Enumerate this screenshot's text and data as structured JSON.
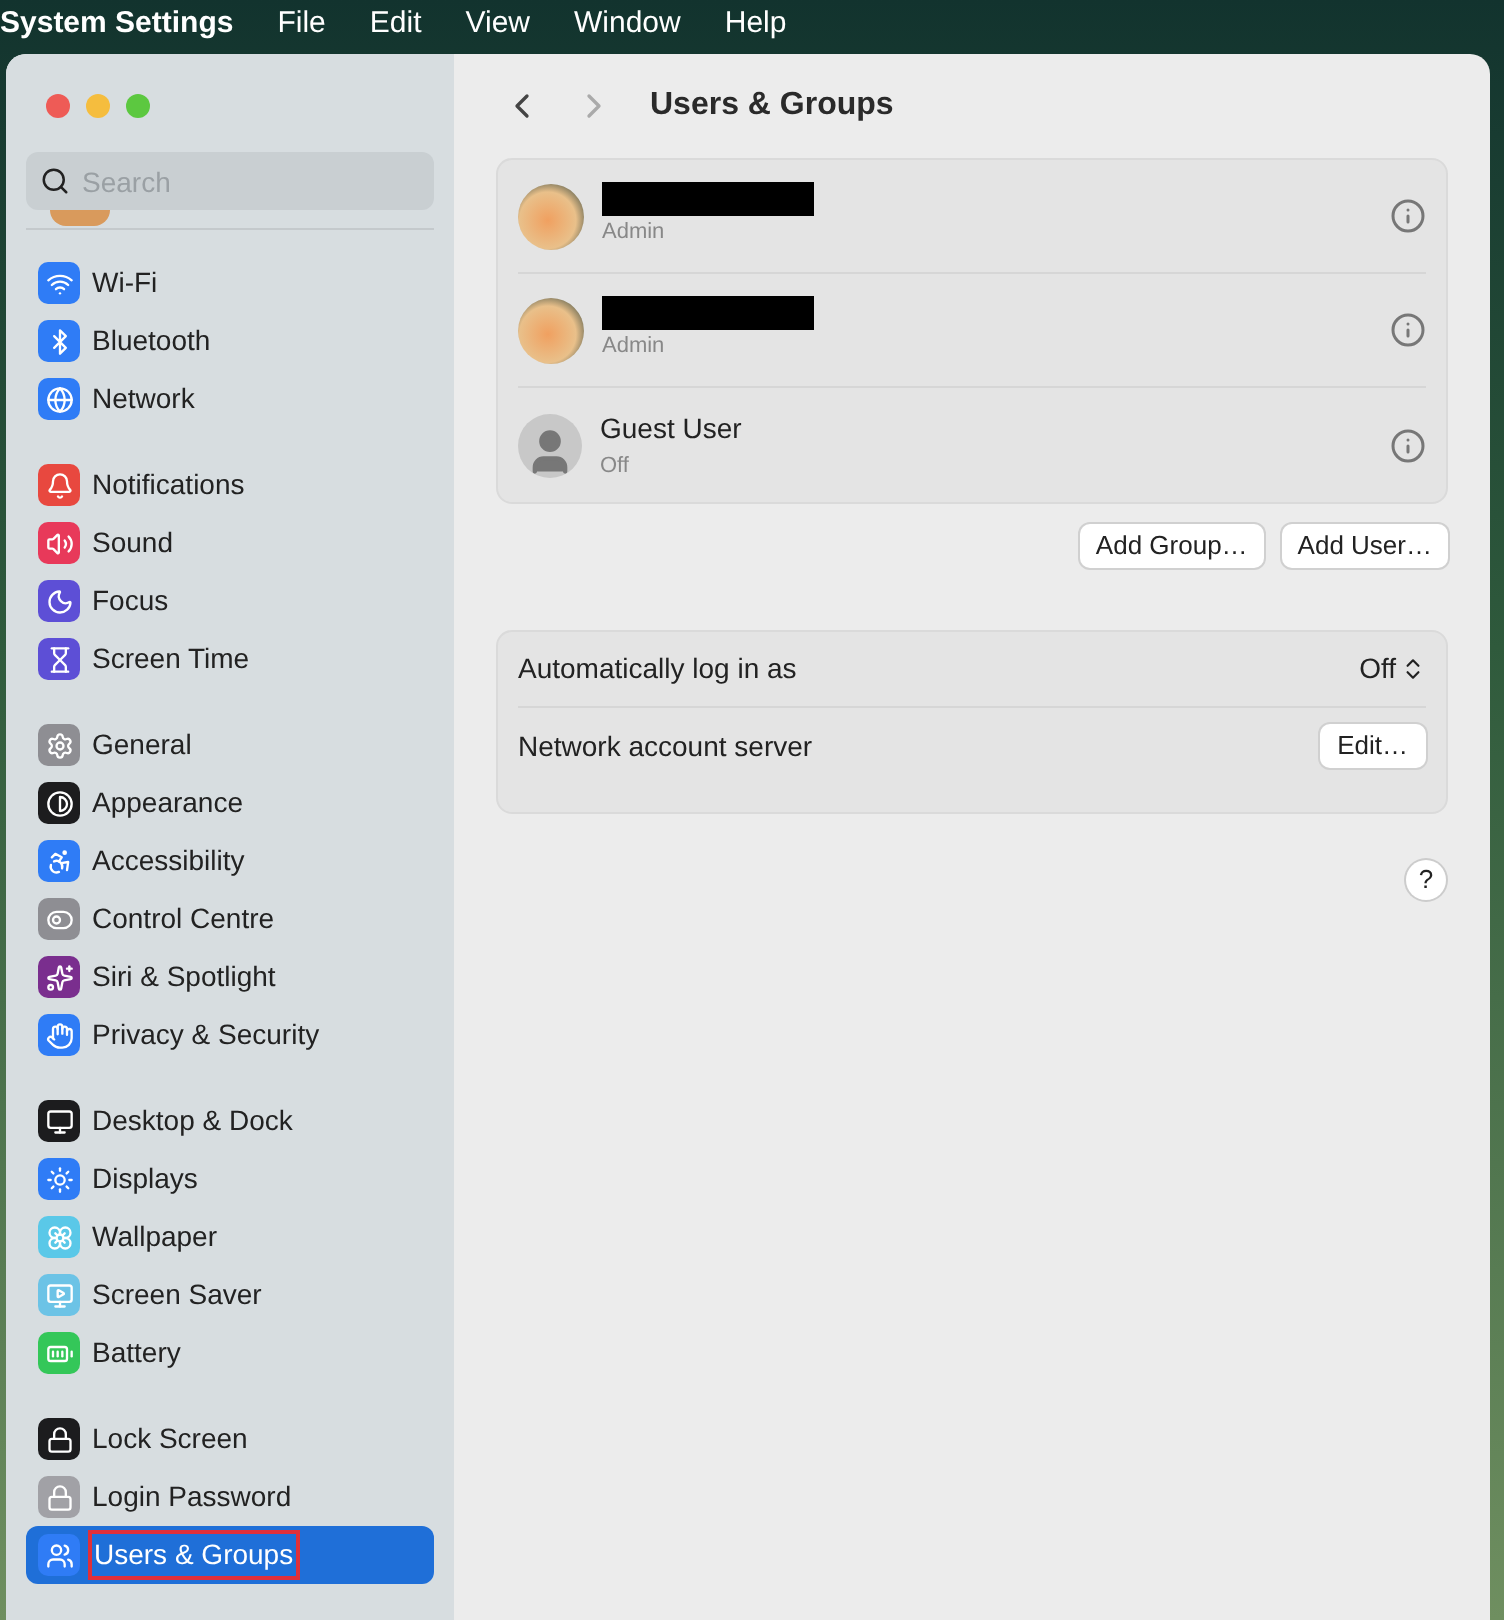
{
  "menu_bar": {
    "app": "System Settings",
    "items": [
      "File",
      "Edit",
      "View",
      "Window",
      "Help"
    ]
  },
  "search": {
    "placeholder": "Search"
  },
  "sidebar": {
    "groups": [
      {
        "items": [
          {
            "label": "Wi-Fi",
            "color": "#2f7cf6",
            "selected": false,
            "highlighted": false
          },
          {
            "label": "Bluetooth",
            "color": "#2f7cf6",
            "selected": false,
            "highlighted": false
          },
          {
            "label": "Network",
            "color": "#2f7cf6",
            "selected": false,
            "highlighted": false
          }
        ]
      },
      {
        "items": [
          {
            "label": "Notifications",
            "color": "#e8483f",
            "selected": false,
            "highlighted": false
          },
          {
            "label": "Sound",
            "color": "#e8395a",
            "selected": false,
            "highlighted": false
          },
          {
            "label": "Focus",
            "color": "#5d4fd6",
            "selected": false,
            "highlighted": false
          },
          {
            "label": "Screen Time",
            "color": "#5d4fd6",
            "selected": false,
            "highlighted": false
          }
        ]
      },
      {
        "items": [
          {
            "label": "General",
            "color": "#8e8e93",
            "selected": false,
            "highlighted": false
          },
          {
            "label": "Appearance",
            "color": "#1c1c1e",
            "selected": false,
            "highlighted": false
          },
          {
            "label": "Accessibility",
            "color": "#2f7cf6",
            "selected": false,
            "highlighted": false
          },
          {
            "label": "Control Centre",
            "color": "#8e8e93",
            "selected": false,
            "highlighted": false
          },
          {
            "label": "Siri & Spotlight",
            "color": "#7a2e8e",
            "selected": false,
            "highlighted": false
          },
          {
            "label": "Privacy & Security",
            "color": "#2f7cf6",
            "selected": false,
            "highlighted": false
          }
        ]
      },
      {
        "items": [
          {
            "label": "Desktop & Dock",
            "color": "#1c1c1e",
            "selected": false,
            "highlighted": false
          },
          {
            "label": "Displays",
            "color": "#2f7cf6",
            "selected": false,
            "highlighted": false
          },
          {
            "label": "Wallpaper",
            "color": "#5ac8e8",
            "selected": false,
            "highlighted": false
          },
          {
            "label": "Screen Saver",
            "color": "#6cc3e6",
            "selected": false,
            "highlighted": false
          },
          {
            "label": "Battery",
            "color": "#34c759",
            "selected": false,
            "highlighted": false
          }
        ]
      },
      {
        "items": [
          {
            "label": "Lock Screen",
            "color": "#1c1c1e",
            "selected": false,
            "highlighted": false
          },
          {
            "label": "Login Password",
            "color": "#a1a1a6",
            "selected": false,
            "highlighted": false
          },
          {
            "label": "Users & Groups",
            "color": "#2f7cf6",
            "selected": true,
            "highlighted": true
          }
        ]
      }
    ]
  },
  "header": {
    "title": "Users & Groups"
  },
  "users": [
    {
      "kind": "photo",
      "redacted": true,
      "role": "Admin"
    },
    {
      "kind": "photo",
      "redacted": true,
      "role": "Admin"
    },
    {
      "kind": "guest",
      "redacted": false,
      "name": "Guest User",
      "role": "Off"
    }
  ],
  "user_buttons": [
    "Add Group…",
    "Add User…"
  ],
  "settings": [
    {
      "kind": "popup",
      "label": "Automatically log in as",
      "value": "Off"
    },
    {
      "kind": "button",
      "label": "Network account server",
      "value": "Edit…"
    }
  ],
  "help": "?"
}
